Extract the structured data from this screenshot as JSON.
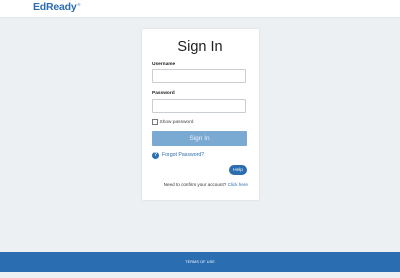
{
  "header": {
    "logo_text": "EdReady",
    "logo_mark": "®"
  },
  "form": {
    "title": "Sign In",
    "username_label": "Username",
    "username_value": "",
    "password_label": "Password",
    "password_value": "",
    "show_password_label": "Show password",
    "show_password_checked": false,
    "signin_label": "Sign In",
    "forgot_label": "Forgot Password?",
    "help_label": "Help",
    "confirm_text": "Need to confirm your account?",
    "confirm_link": "Click here"
  },
  "footer": {
    "terms_label": "TERMS OF USE"
  },
  "colors": {
    "brand": "#2a6db0",
    "button_disabled": "#7aa9d2",
    "background": "#edf0f3"
  }
}
